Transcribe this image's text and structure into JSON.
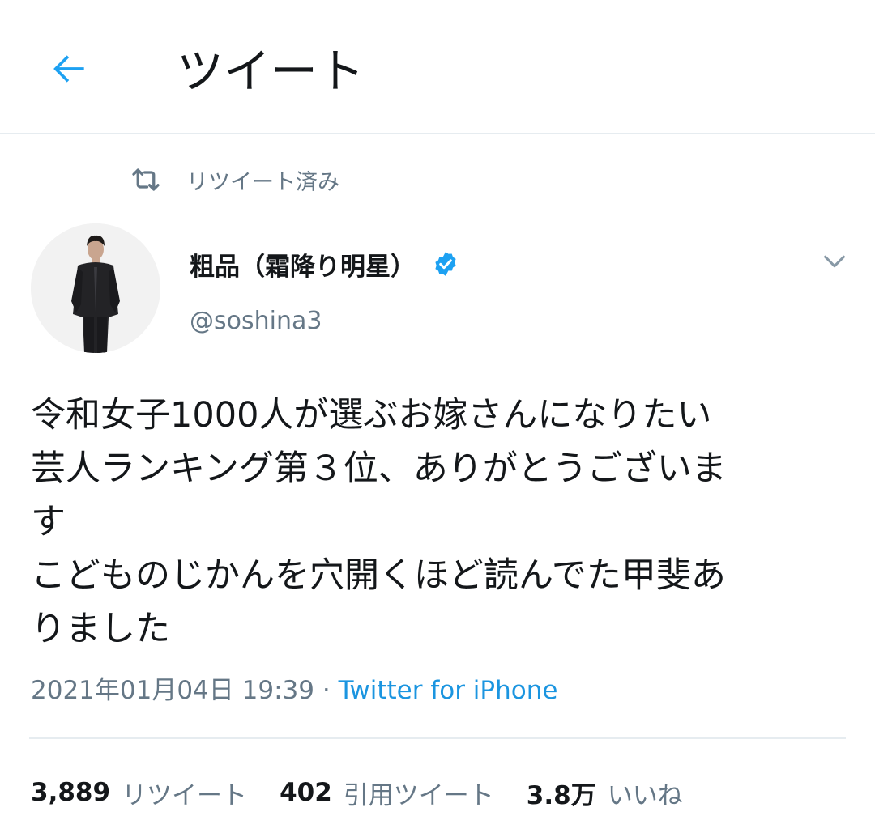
{
  "header": {
    "title": "ツイート",
    "back_icon": "arrow-left-icon"
  },
  "colors": {
    "accent": "#1da1f2",
    "link": "#1b95e0",
    "secondary_text": "#657786",
    "primary_text": "#14171a",
    "divider": "#e6ecf0"
  },
  "social_context": {
    "icon": "retweet-icon",
    "text": "リツイート済み"
  },
  "tweet": {
    "author": {
      "display_name": "粗品（霜降り明星）",
      "handle": "@soshina3",
      "verified": true
    },
    "text_lines": [
      "令和女子1000人が選ぶお嫁さんになりたい",
      "芸人ランキング第３位、ありがとうございま",
      "す",
      "こどものじかんを穴開くほど読んでた甲斐あ",
      "りました"
    ],
    "timestamp": "2021年01月04日 19:39",
    "separator": "·",
    "source": "Twitter for iPhone"
  },
  "stats": [
    {
      "value": "3,889",
      "label": "リツイート"
    },
    {
      "value": "402",
      "label": "引用ツイート"
    },
    {
      "value": "3.8万",
      "label": "いいね"
    }
  ]
}
